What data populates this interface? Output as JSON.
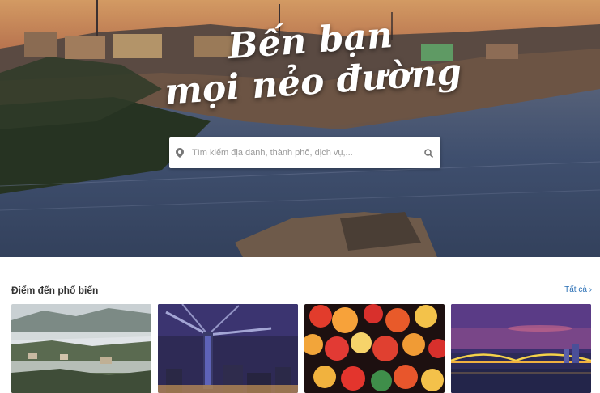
{
  "hero": {
    "title_line1": "Bến bạn",
    "title_line2": "mọi nẻo đường"
  },
  "search": {
    "placeholder": "Tìm kiếm địa danh, thành phố, dịch vụ,...",
    "pin_icon": "map-pin-icon",
    "search_icon": "magnifier-icon"
  },
  "destinations": {
    "title": "Điểm đến phổ biến",
    "see_all": "Tất cả ›"
  },
  "colors": {
    "link": "#2a6fb5",
    "heading": "#333333"
  }
}
